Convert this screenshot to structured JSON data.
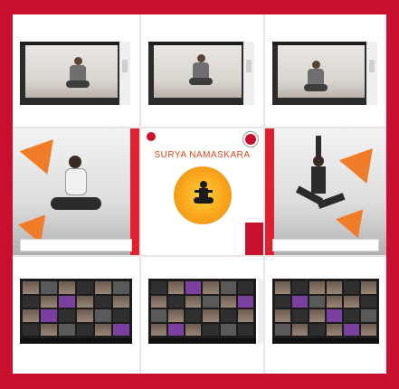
{
  "collage": {
    "border_color": "#c8102e",
    "accent_orange": "#f07c2a",
    "call_screens": [
      {
        "icon": "video-call-screenshot"
      },
      {
        "icon": "video-call-screenshot"
      },
      {
        "icon": "video-call-screenshot"
      }
    ],
    "posters": {
      "left_caption": "",
      "center_org": "",
      "center_title": "SURYA NAMASKARA",
      "right_caption": ""
    },
    "galleries": [
      {
        "icon": "gallery-view-meeting"
      },
      {
        "icon": "gallery-view-meeting"
      },
      {
        "icon": "gallery-view-meeting"
      }
    ]
  }
}
